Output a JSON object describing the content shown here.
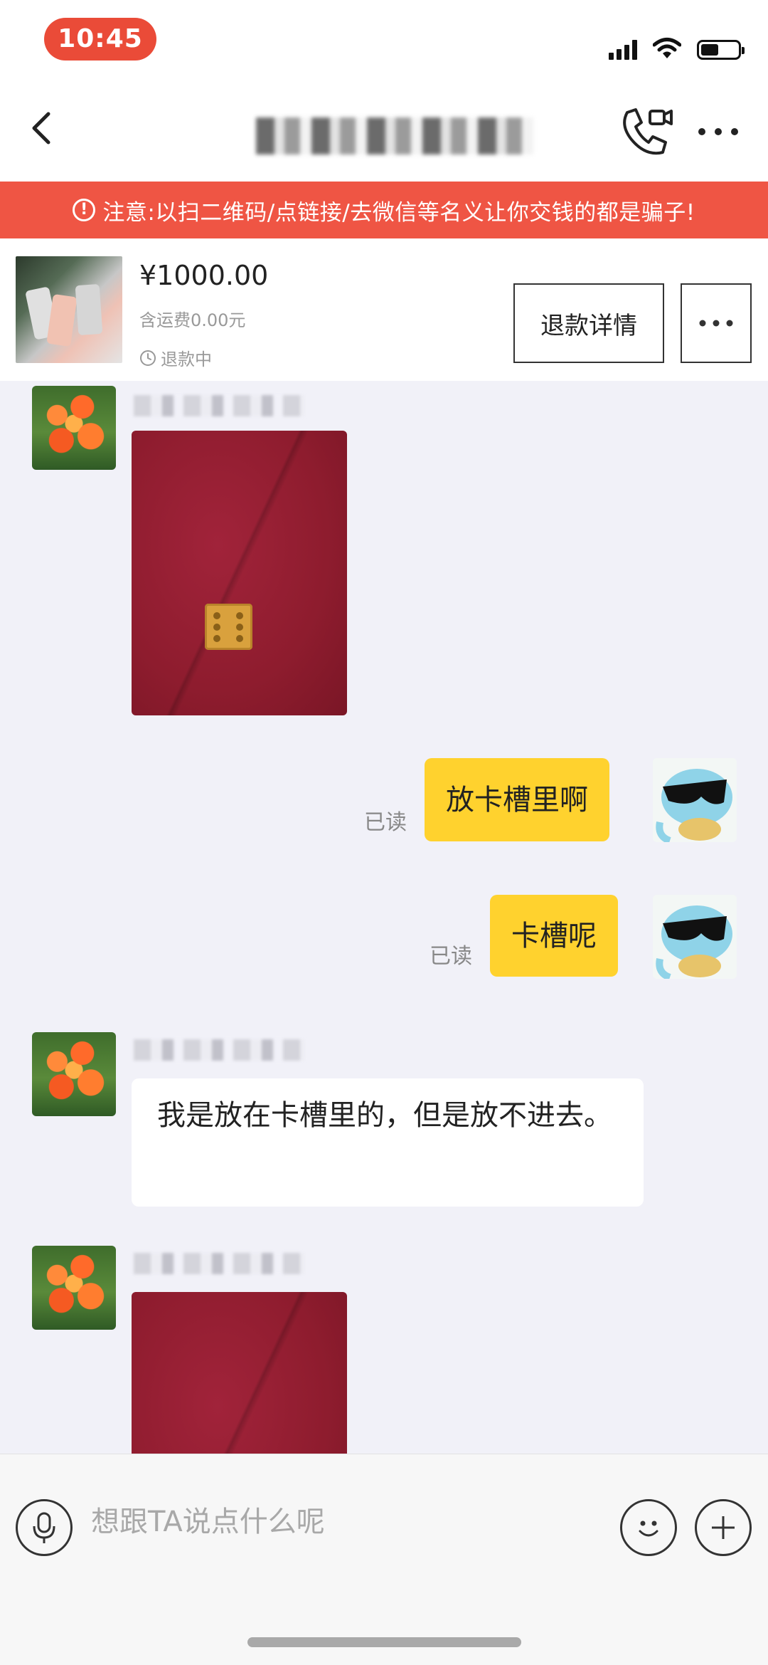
{
  "status_bar": {
    "time": "10:45",
    "icons": [
      "signal-icon",
      "wifi-icon",
      "battery-icon"
    ]
  },
  "nav": {
    "title": "",
    "icons": [
      "back-icon",
      "video-call-icon",
      "more-icon"
    ]
  },
  "warning": {
    "text": "注意:以扫二维码/点链接/去微信等名义让你交钱的都是骗子!",
    "icon": "warning-circle-icon"
  },
  "product": {
    "price": "¥1000.00",
    "shipping": "含运费0.00元",
    "status": "退款中",
    "refund_button": "退款详情"
  },
  "messages": [
    {
      "side": "left",
      "type": "image",
      "sender": ""
    },
    {
      "side": "right",
      "type": "text",
      "text": "放卡槽里啊",
      "read": "已读"
    },
    {
      "side": "right",
      "type": "text",
      "text": "卡槽呢",
      "read": "已读"
    },
    {
      "side": "left",
      "type": "text",
      "sender": "",
      "text": "我是放在卡槽里的，但是放不进去。"
    },
    {
      "side": "left",
      "type": "image",
      "sender": ""
    }
  ],
  "input": {
    "placeholder": "想跟TA说点什么呢"
  },
  "colors": {
    "accent_red": "#ef5544",
    "time_pill": "#ea4b38",
    "bubble_yellow": "#ffd22e",
    "chat_bg": "#f1f1f8"
  }
}
